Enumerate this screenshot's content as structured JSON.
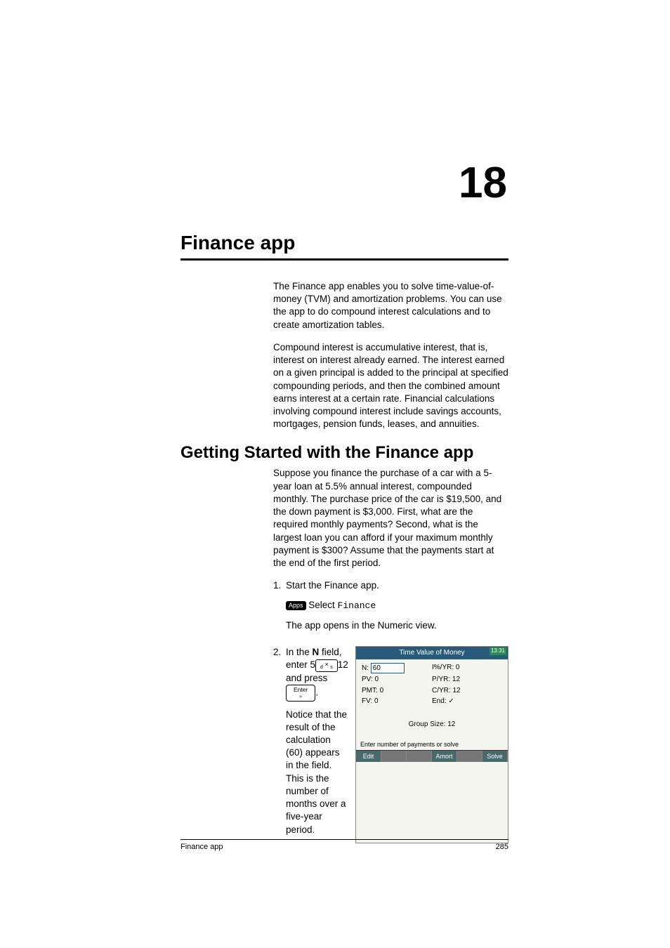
{
  "chapter_num": "18",
  "main_title": "Finance app",
  "intro_p1": "The Finance app enables you to solve time-value-of-money (TVM) and amortization problems. You can use the app to do compound interest calculations and to create amortization tables.",
  "intro_p2": "Compound interest is accumulative interest, that is, interest on interest already earned. The interest earned on a given principal is added to the principal at specified compounding periods, and then the combined amount earns interest at a certain rate. Financial calculations involving compound interest include savings accounts, mortgages, pension funds, leases, and annuities.",
  "section_title": "Getting Started with the Finance app",
  "section_p1": "Suppose you finance the purchase of a car with a 5-year loan at 5.5% annual interest, compounded monthly. The purchase price of the car is $19,500, and the down payment is $3,000. First, what are the required monthly payments? Second, what is the largest loan you can afford if your maximum monthly payment is $300? Assume that the payments start at the end of the first period.",
  "step1_num": "1.",
  "step1_text": "Start the Finance app.",
  "step1_key": "Apps",
  "step1_select": " Select ",
  "step1_finance": "Finance",
  "step1_opens": "The app opens in the Numeric view.",
  "step2_num": "2.",
  "step2_inthe": "In the ",
  "step2_N": "N",
  "step2_field": " field, enter 5",
  "step2_mult": "×",
  "step2_mult_sub": "÷",
  "step2_12": "12 and press ",
  "step2_enter": "Enter",
  "step2_dot": ".",
  "step2_notice": "Notice that the result of the calculation (60) appears in the field. This is the number of months over a five-year period.",
  "screenshot": {
    "title": "Time Value of Money",
    "time": "13:31",
    "n_label": "N:",
    "n_val": "60",
    "iyr_label": "I%/YR:",
    "iyr_val": "0",
    "pv_label": "PV:",
    "pv_val": "0",
    "pyr_label": "P/YR:",
    "pyr_val": "12",
    "pmt_label": "PMT:",
    "pmt_val": "0",
    "cyr_label": "C/YR:",
    "cyr_val": "12",
    "fv_label": "FV:",
    "fv_val": "0",
    "end_label": "End:",
    "end_val": "✓",
    "group": "Group Size: 12",
    "hint": "Enter number of payments or solve",
    "menu_edit": "Edit",
    "menu_amort": "Amort",
    "menu_solve": "Solve"
  },
  "footer_left": "Finance app",
  "footer_right": "285"
}
